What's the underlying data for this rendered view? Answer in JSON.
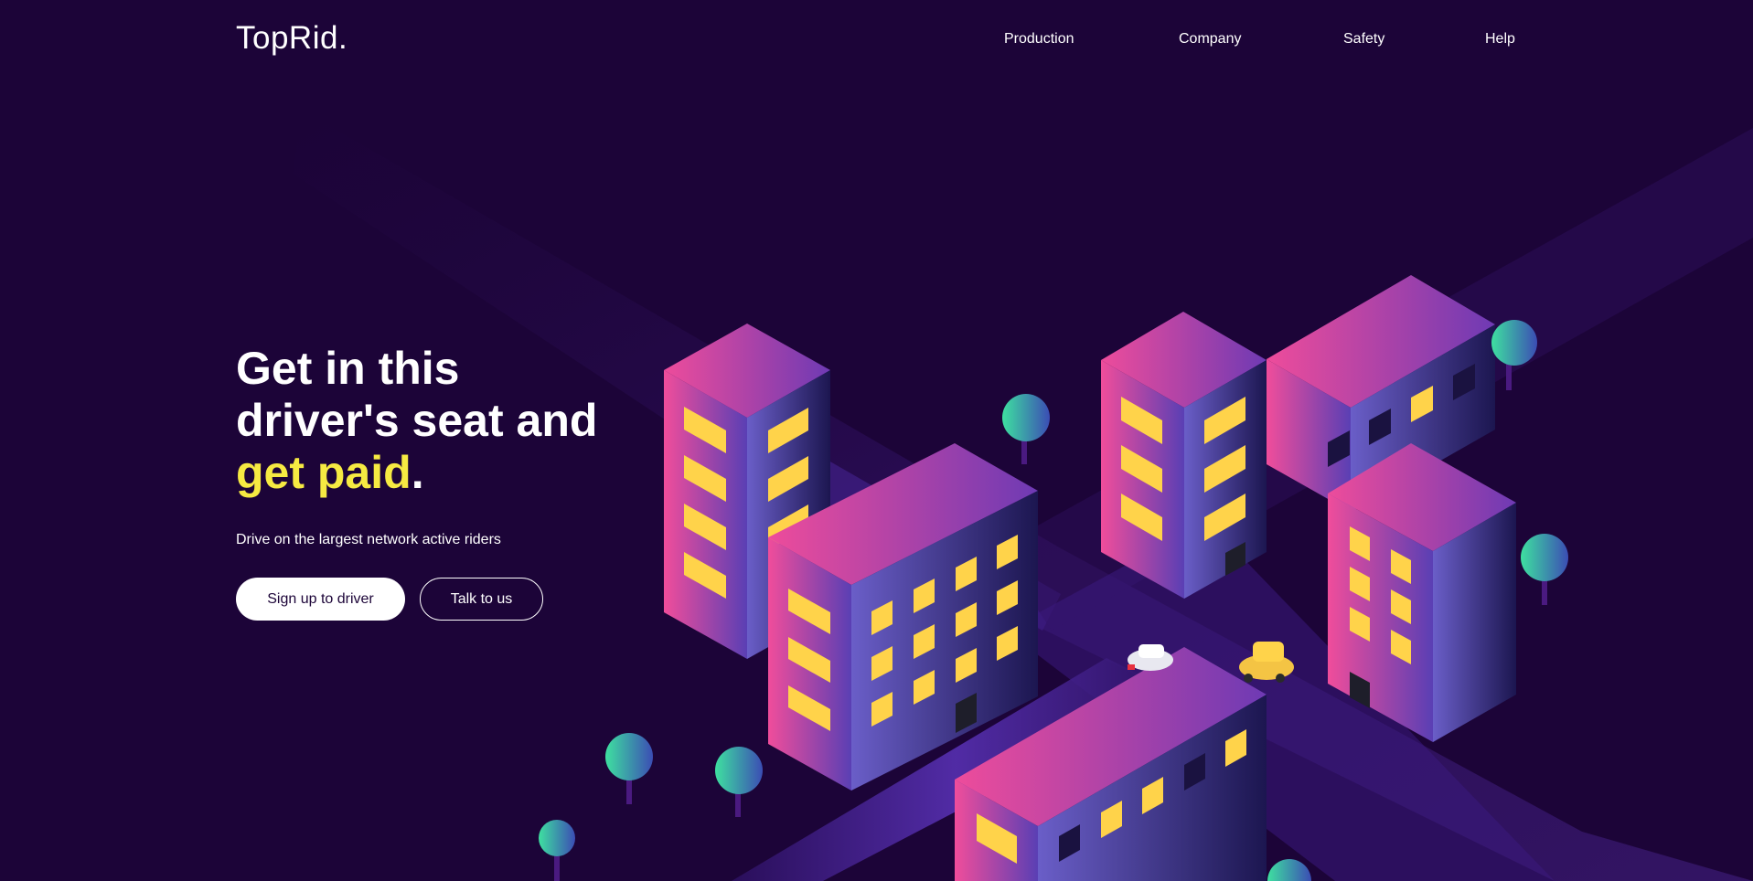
{
  "brand": {
    "logo": "TopRid."
  },
  "nav": {
    "items": [
      "Production",
      "Company",
      "Safety",
      "Help"
    ]
  },
  "hero": {
    "headline_line1": "Get in this",
    "headline_line2": "driver's seat and",
    "headline_accent": "get paid",
    "headline_period": ".",
    "subtitle": "Drive on the largest network active riders",
    "primary_button": "Sign up to driver",
    "secondary_button": "Talk to us"
  },
  "colors": {
    "background": "#1c0438",
    "accent_yellow": "#f6ea42",
    "building_pink": "#e94e9e",
    "building_violet": "#6a3bb0",
    "window_yellow": "#ffd34a",
    "tree_teal": "#3ecf9a"
  },
  "illustration": {
    "name": "isometric-city-illustration"
  }
}
